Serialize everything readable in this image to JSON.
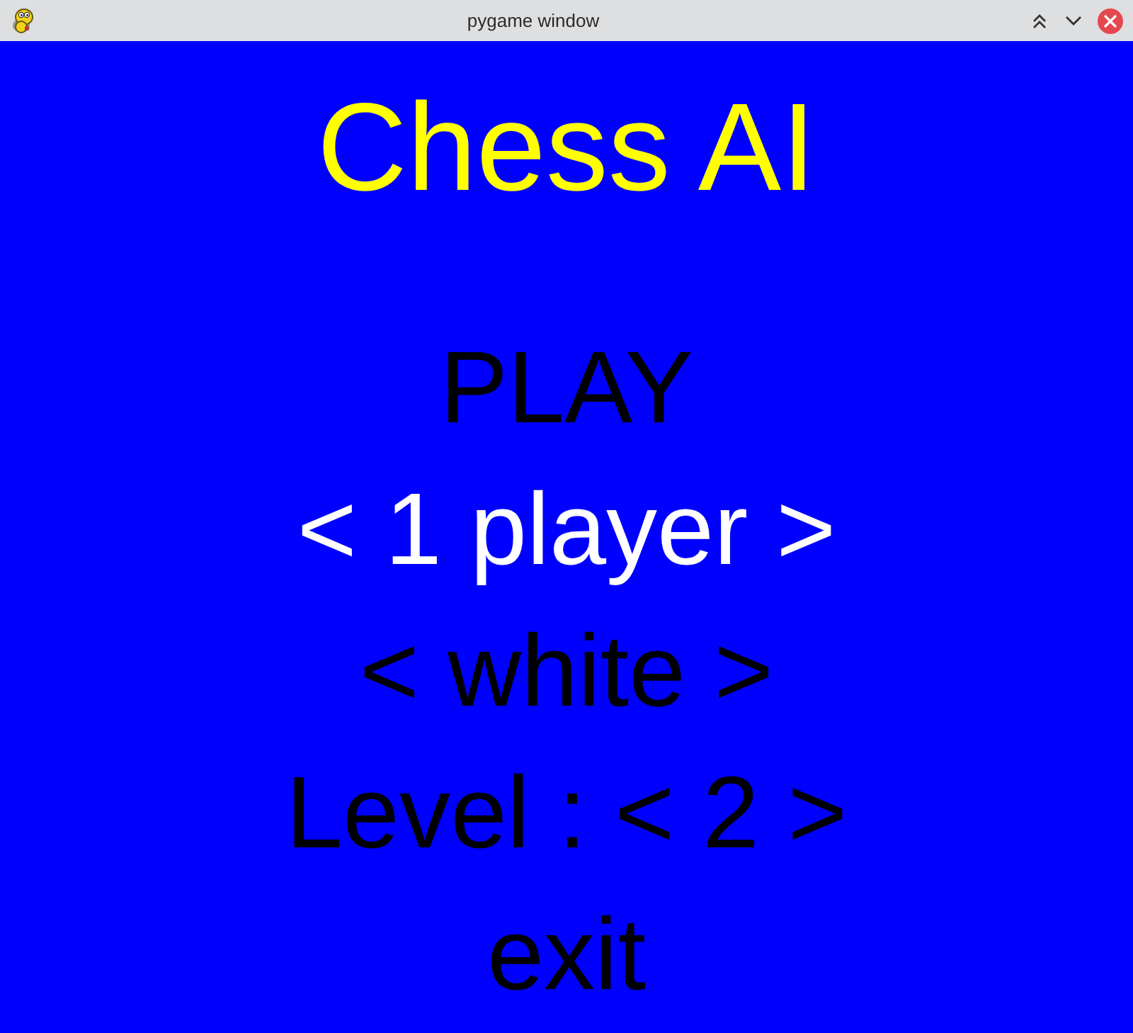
{
  "window": {
    "title": "pygame window"
  },
  "game_title": "Chess AI",
  "menu": [
    {
      "label": "PLAY",
      "selected": false
    },
    {
      "label": "< 1 player >",
      "selected": true
    },
    {
      "label": "< white >",
      "selected": false
    },
    {
      "label": "Level : < 2 >",
      "selected": false
    },
    {
      "label": "exit",
      "selected": false
    }
  ]
}
